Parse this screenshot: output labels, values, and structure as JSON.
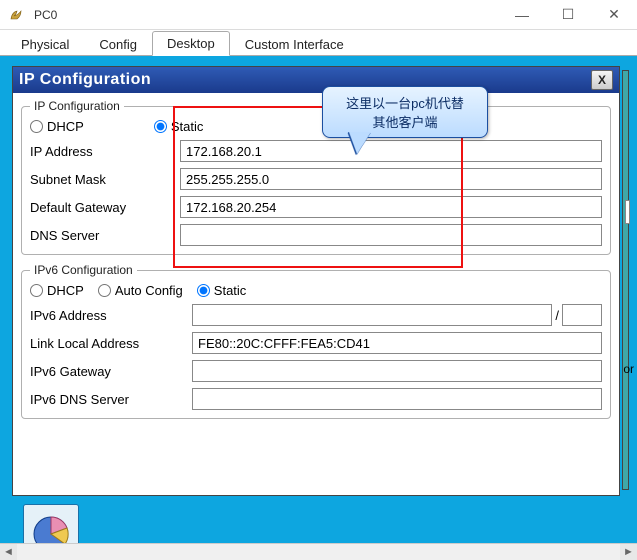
{
  "window": {
    "title": "PC0",
    "min": "—",
    "max": "☐",
    "close": "✕"
  },
  "tabs": [
    {
      "label": "Physical"
    },
    {
      "label": "Config"
    },
    {
      "label": "Desktop"
    },
    {
      "label": "Custom Interface"
    }
  ],
  "config": {
    "title": "IP Configuration",
    "close": "X",
    "ipv4": {
      "legend": "IP Configuration",
      "dhcp": "DHCP",
      "static": "Static",
      "mode": "static",
      "labels": {
        "ip": "IP Address",
        "mask": "Subnet Mask",
        "gw": "Default Gateway",
        "dns": "DNS Server"
      },
      "values": {
        "ip": "172.168.20.1",
        "mask": "255.255.255.0",
        "gw": "172.168.20.254",
        "dns": ""
      }
    },
    "ipv6": {
      "legend": "IPv6 Configuration",
      "dhcp": "DHCP",
      "auto": "Auto Config",
      "static": "Static",
      "mode": "static",
      "labels": {
        "addr": "IPv6 Address",
        "ll": "Link Local Address",
        "gw": "IPv6 Gateway",
        "dns": "IPv6 DNS Server",
        "slash": "/"
      },
      "values": {
        "addr": "",
        "prefix": "",
        "ll": "FE80::20C:CFFF:FEA5:CD41",
        "gw": "",
        "dns": ""
      }
    }
  },
  "callout": {
    "line1": "这里以一台pc机代替",
    "line2": "其他客户端"
  },
  "edge": {
    "or": "or"
  }
}
